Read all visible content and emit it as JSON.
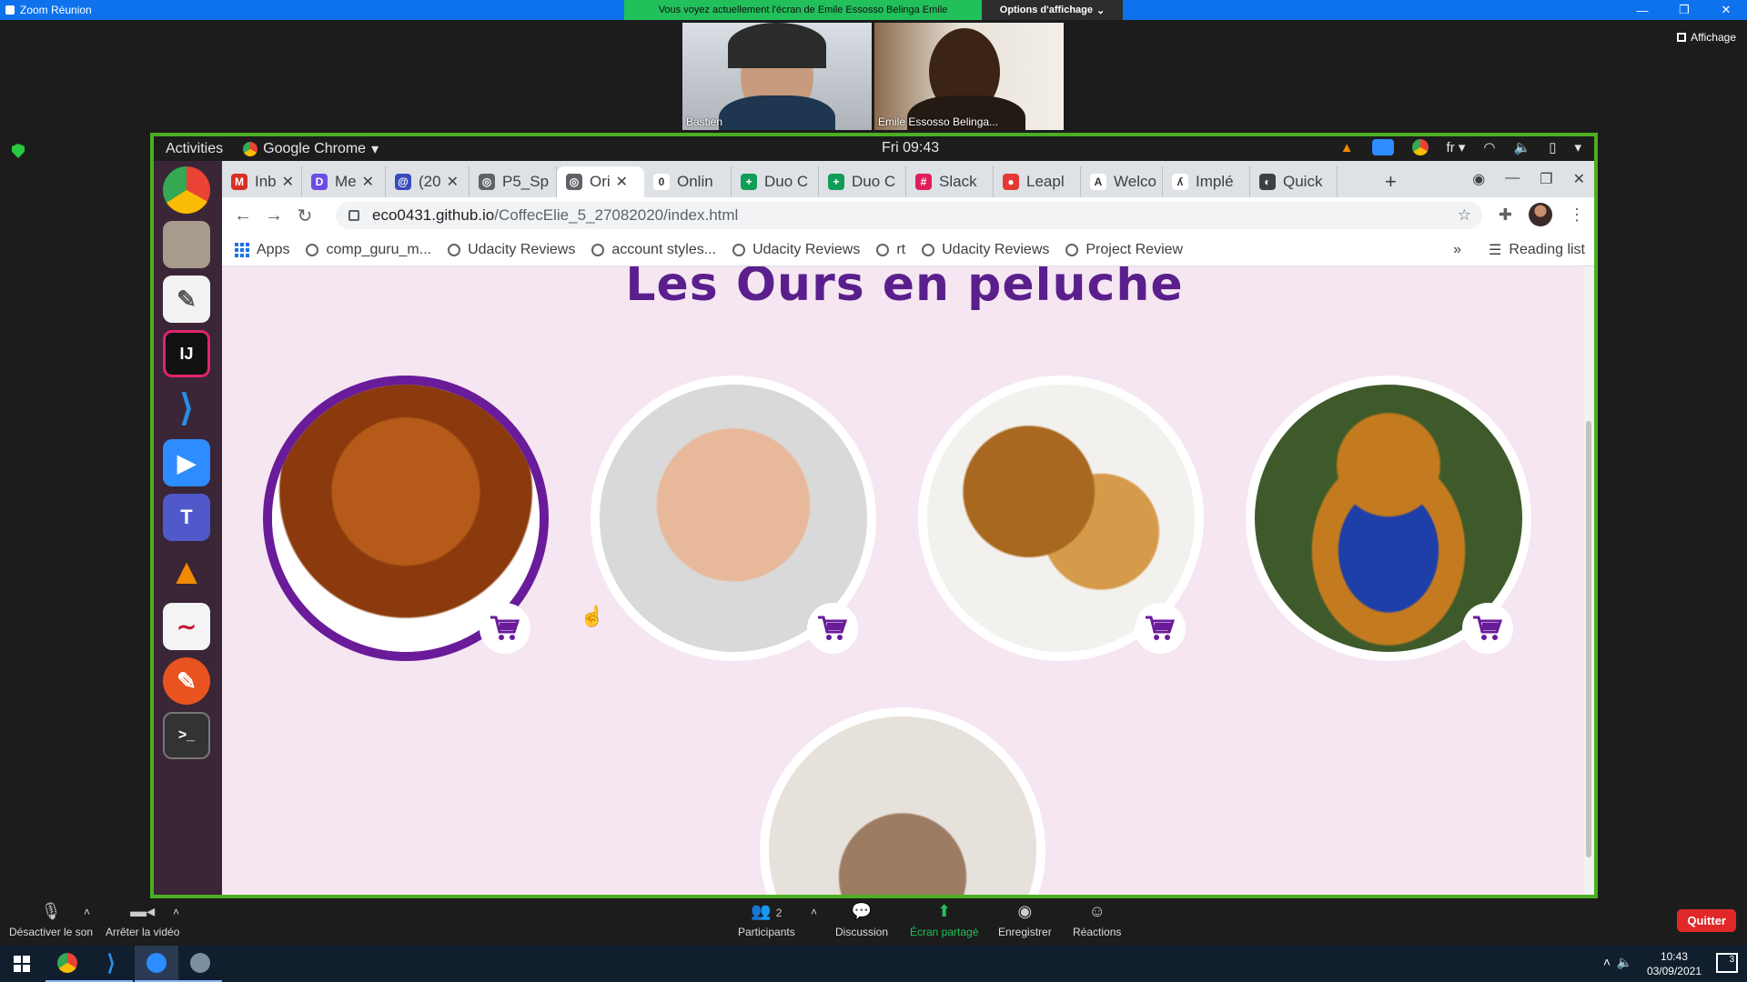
{
  "zoom": {
    "window_title": "Zoom Réunion",
    "share_banner": "Vous voyez actuellement l'écran de Emile Essosso Belinga Emile",
    "view_options": "Options d'affichage",
    "affichage": "Affichage",
    "participants": [
      {
        "name": "Bastien"
      },
      {
        "name": "Emile Essosso Belinga..."
      }
    ],
    "toolbar": {
      "mute": "Désactiver le son",
      "video": "Arrêter la vidéo",
      "participants": "Participants",
      "participants_count": "2",
      "chat": "Discussion",
      "share": "Écran partagé",
      "record": "Enregistrer",
      "reactions": "Réactions",
      "quit": "Quitter"
    }
  },
  "gnome": {
    "activities": "Activities",
    "app": "Google Chrome",
    "clock": "Fri 09:43",
    "lang": "fr"
  },
  "chrome": {
    "tabs": [
      {
        "label": "Inb",
        "color": "#d93025",
        "letter": "M"
      },
      {
        "label": "Me",
        "color": "#6b4de6",
        "letter": "D"
      },
      {
        "label": "(20",
        "color": "#3a4cba",
        "letter": "@"
      },
      {
        "label": "P5_Sp",
        "color": "#5f6368",
        "letter": "◎"
      },
      {
        "label": "Ori",
        "color": "#5f6368",
        "letter": "◎",
        "active": true
      },
      {
        "label": "Onlin",
        "color": "#ffffff",
        "letter": "0"
      },
      {
        "label": "Duo C",
        "color": "#0f9d58",
        "letter": "+"
      },
      {
        "label": "Duo C",
        "color": "#0f9d58",
        "letter": "+"
      },
      {
        "label": "Slack",
        "color": "#e01e5a",
        "letter": "#"
      },
      {
        "label": "Leapl",
        "color": "#e53935",
        "letter": "●"
      },
      {
        "label": "Welco",
        "color": "#ffffff",
        "letter": "A"
      },
      {
        "label": "Implé",
        "color": "#ffffff",
        "letter": "ʎ"
      },
      {
        "label": "Quick",
        "color": "#3c4043",
        "letter": "◐"
      }
    ],
    "url_host": "eco0431.github.io",
    "url_path": "/CoffecElie_5_27082020/index.html",
    "bookmarks": [
      "Apps",
      "comp_guru_m...",
      "Udacity Reviews",
      "account styles...",
      "Udacity Reviews",
      "rt",
      "Udacity Reviews",
      "Project Review"
    ],
    "reading_list": "Reading list",
    "more": "»"
  },
  "page": {
    "title": "Les Ours en peluche",
    "products": [
      {
        "name": "teddy-brown"
      },
      {
        "name": "teddy-beige"
      },
      {
        "name": "teddy-pair"
      },
      {
        "name": "teddy-blue-shirt"
      },
      {
        "name": "teddy-back"
      }
    ]
  },
  "taskbar": {
    "time": "10:43",
    "date": "03/09/2021",
    "notifications": "3"
  }
}
